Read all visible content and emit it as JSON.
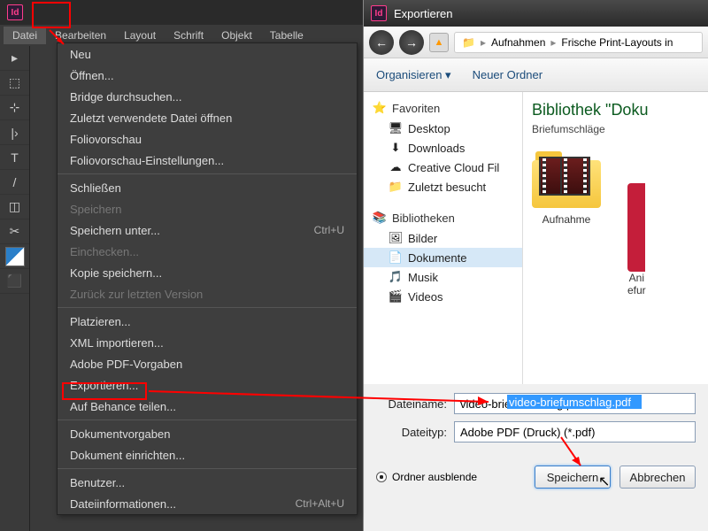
{
  "app": {
    "logo_text": "Id",
    "menubar": [
      "Datei",
      "Bearbeiten",
      "Layout",
      "Schrift",
      "Objekt",
      "Tabelle"
    ]
  },
  "tools": [
    "▸",
    "⬚",
    "⊹",
    "|›",
    "T",
    "/",
    "◫",
    "✂",
    "⬛"
  ],
  "file_menu": {
    "items": [
      {
        "label": "Neu",
        "shortcut": "",
        "disabled": false
      },
      {
        "label": "Öffnen...",
        "shortcut": "",
        "disabled": false
      },
      {
        "label": "Bridge durchsuchen...",
        "shortcut": "",
        "disabled": false
      },
      {
        "label": "Zuletzt verwendete Datei öffnen",
        "shortcut": "",
        "disabled": false
      },
      {
        "label": "Foliovorschau",
        "shortcut": "",
        "disabled": false
      },
      {
        "label": "Foliovorschau-Einstellungen...",
        "shortcut": "",
        "disabled": false
      },
      {
        "sep": true
      },
      {
        "label": "Schließen",
        "shortcut": "",
        "disabled": false
      },
      {
        "label": "Speichern",
        "shortcut": "",
        "disabled": true
      },
      {
        "label": "Speichern unter...",
        "shortcut": "Ctrl+U",
        "disabled": false
      },
      {
        "label": "Einchecken...",
        "shortcut": "",
        "disabled": true
      },
      {
        "label": "Kopie speichern...",
        "shortcut": "",
        "disabled": false
      },
      {
        "label": "Zurück zur letzten Version",
        "shortcut": "",
        "disabled": true
      },
      {
        "sep": true
      },
      {
        "label": "Platzieren...",
        "shortcut": "",
        "disabled": false
      },
      {
        "label": "XML importieren...",
        "shortcut": "",
        "disabled": false
      },
      {
        "label": "Adobe PDF-Vorgaben",
        "shortcut": "",
        "disabled": false
      },
      {
        "label": "Exportieren...",
        "shortcut": "",
        "disabled": false,
        "highlight": true
      },
      {
        "label": "Auf Behance teilen...",
        "shortcut": "",
        "disabled": false
      },
      {
        "sep": true
      },
      {
        "label": "Dokumentvorgaben",
        "shortcut": "",
        "disabled": false
      },
      {
        "label": "Dokument einrichten...",
        "shortcut": "",
        "disabled": false
      },
      {
        "sep": true
      },
      {
        "label": "Benutzer...",
        "shortcut": "",
        "disabled": false
      },
      {
        "label": "Dateiinformationen...",
        "shortcut": "Ctrl+Alt+U",
        "disabled": false
      }
    ]
  },
  "dialog": {
    "title": "Exportieren",
    "nav": {
      "back": "←",
      "fwd": "→",
      "up": "▲",
      "crumbs": [
        "Aufnahmen",
        "Frische Print-Layouts in"
      ]
    },
    "toolbar": {
      "organize": "Organisieren ▾",
      "newfolder": "Neuer Ordner"
    },
    "sidebar": {
      "favorites": "Favoriten",
      "fav_items": [
        {
          "ico": "🖥",
          "label": "Desktop"
        },
        {
          "ico": "⬇",
          "label": "Downloads"
        },
        {
          "ico": "☁",
          "label": "Creative Cloud Fil"
        },
        {
          "ico": "📁",
          "label": "Zuletzt besucht"
        }
      ],
      "libraries": "Bibliotheken",
      "lib_items": [
        {
          "ico": "🖼",
          "label": "Bilder"
        },
        {
          "ico": "📄",
          "label": "Dokumente",
          "sel": true
        },
        {
          "ico": "🎵",
          "label": "Musik"
        },
        {
          "ico": "🎬",
          "label": "Videos"
        }
      ]
    },
    "main": {
      "title": "Bibliothek \"Doku",
      "subtitle": "Briefumschläge",
      "folders": [
        {
          "name": "Aufnahme"
        },
        {
          "name": "Ani\nefur"
        }
      ]
    },
    "fields": {
      "filename_label": "Dateiname:",
      "filename_value": "video-briefumschlag.pdf",
      "filetype_label": "Dateityp:",
      "filetype_value": "Adobe PDF (Druck) (*.pdf)"
    },
    "footer": {
      "hide_folders": "Ordner ausblende",
      "save": "Speichern",
      "cancel": "Abbrechen"
    }
  }
}
